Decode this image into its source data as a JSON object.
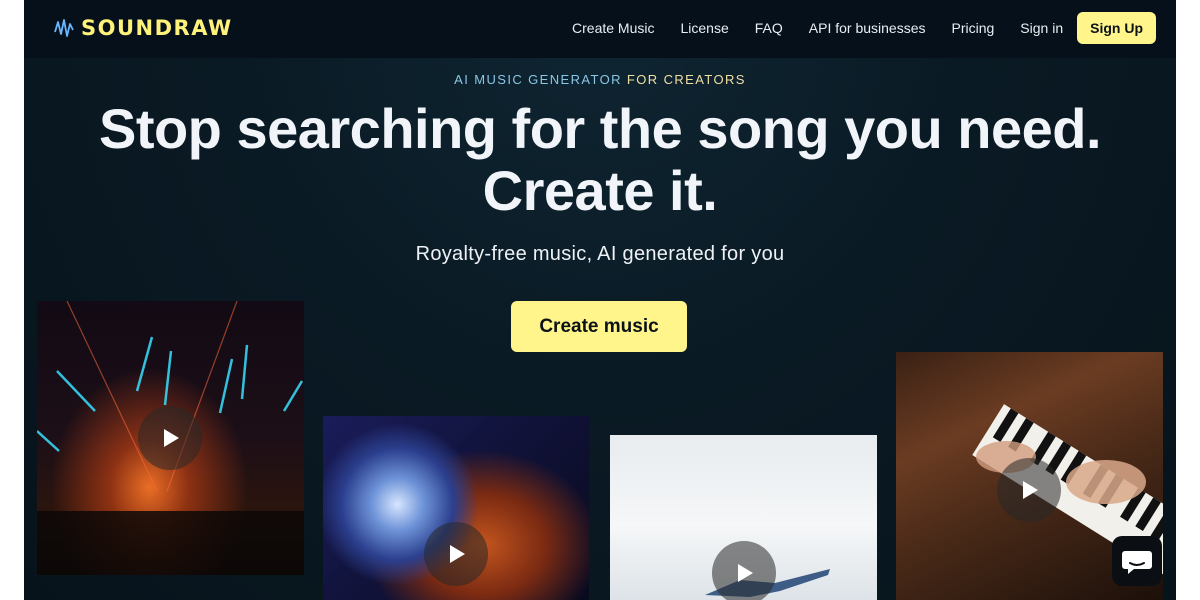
{
  "brand": {
    "name": "SOUNDRAW",
    "logo_icon": "soundwave-icon",
    "color": "#fff27a"
  },
  "nav": {
    "items": [
      "Create Music",
      "License",
      "FAQ",
      "API for businesses",
      "Pricing",
      "Sign in"
    ],
    "signup_label": "Sign Up"
  },
  "hero": {
    "eyebrow_part1": "AI MUSIC GENERATOR",
    "eyebrow_part2": " FOR CREATORS",
    "headline_line1": "Stop searching for the song you need.",
    "headline_line2": "Create it.",
    "subheadline": "Royalty-free music, AI generated for you",
    "cta_label": "Create music"
  },
  "cards": [
    {
      "name": "concert-lights",
      "icon": "play-icon"
    },
    {
      "name": "disco-ball-singer",
      "icon": "play-icon"
    },
    {
      "name": "dancer-white-corridor",
      "icon": "play-icon"
    },
    {
      "name": "piano-player",
      "icon": "play-icon"
    }
  ],
  "chat_widget": {
    "icon": "chat-bubble-icon"
  },
  "colors": {
    "accent": "#fff58a",
    "background": "#07131b",
    "topbar": "#06101a"
  }
}
